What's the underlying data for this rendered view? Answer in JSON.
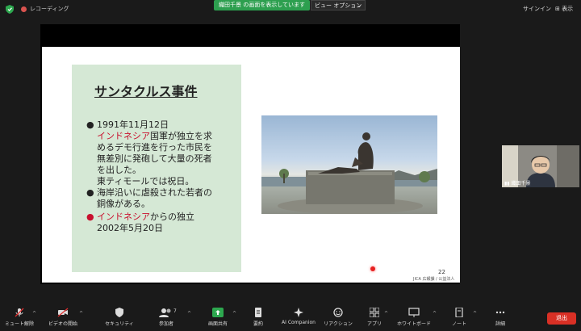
{
  "topbar": {
    "recording_label": "レコーディング",
    "share_banner": "織田千景 の画面を表示しています",
    "view_options_label": "ビュー オプション",
    "signin_label": "サインイン",
    "display_label": "表示"
  },
  "slide": {
    "title": "サンタクルス事件",
    "bullets": [
      {
        "lines": [
          {
            "text": "1991年11月12日",
            "red": ""
          },
          {
            "red": "インドネシア",
            "text": "国軍が独立を求"
          },
          {
            "text": "めるデモ行進を行った市民を",
            "red": ""
          },
          {
            "text": "無差別に発砲して大量の死者",
            "red": ""
          },
          {
            "text": "を出した。",
            "red": ""
          },
          {
            "text": "東ティモールでは祝日。",
            "red": ""
          }
        ]
      },
      {
        "lines": [
          {
            "text": "海岸沿いに虐殺された若者の",
            "red": ""
          },
          {
            "text": "銅像がある。",
            "red": ""
          }
        ]
      },
      {
        "lines": [
          {
            "red": "インドネシア",
            "text": "からの独立"
          },
          {
            "text": "2002年5月20日",
            "red": ""
          }
        ]
      }
    ],
    "page_number": "22",
    "credit": "JICA 広報課 / 公益法人"
  },
  "participant": {
    "name": "織田千景"
  },
  "toolbar": {
    "items": [
      {
        "label": "ミュート解除",
        "icon": "mic-muted-icon"
      },
      {
        "label": "ビデオの開始",
        "icon": "video-off-icon"
      },
      {
        "label": "セキュリティ",
        "icon": "shield-icon"
      },
      {
        "label": "参加者",
        "icon": "participants-icon",
        "count": "7"
      },
      {
        "label": "画面共有",
        "icon": "share-screen-icon"
      },
      {
        "label": "要約",
        "icon": "summary-icon"
      },
      {
        "label": "AI Companion",
        "icon": "ai-companion-icon"
      },
      {
        "label": "リアクション",
        "icon": "reaction-icon"
      },
      {
        "label": "アプリ",
        "icon": "apps-icon"
      },
      {
        "label": "ホワイトボード",
        "icon": "whiteboard-icon"
      },
      {
        "label": "ノート",
        "icon": "notes-icon"
      },
      {
        "label": "詳細",
        "icon": "more-icon"
      }
    ],
    "leave_label": "退出"
  },
  "colors": {
    "share_banner": "#2d9f4f",
    "leave_button": "#d93025",
    "slide_panel": "#d5e8d5",
    "emphasis_red": "#c8102e"
  }
}
